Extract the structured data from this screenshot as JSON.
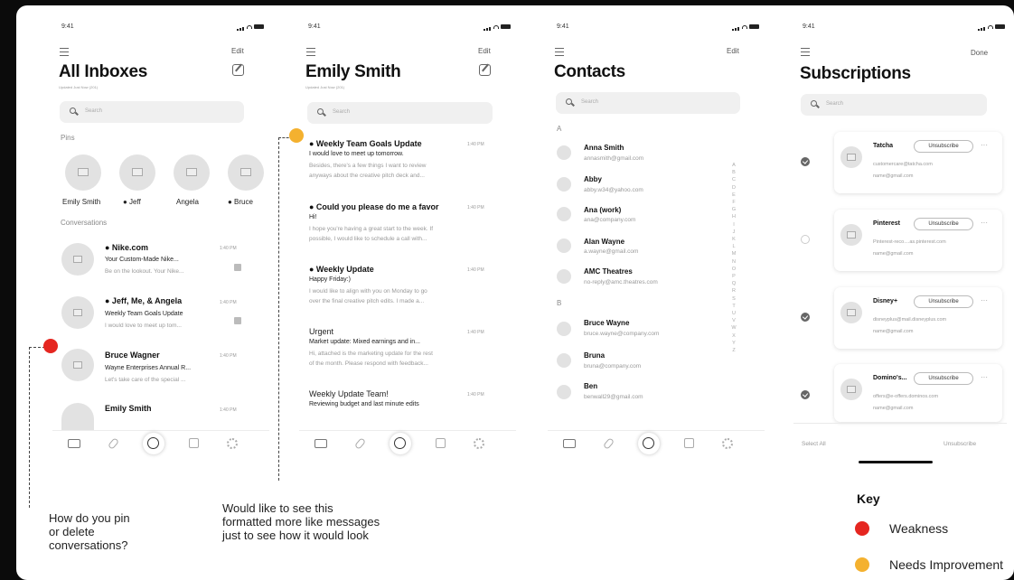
{
  "colors": {
    "weakness": "#e52620",
    "needs_improvement": "#f4b12f",
    "ink": "#111111",
    "muted": "#999999",
    "surface": "#f0f0f0"
  },
  "status_time": "9:41",
  "inboxes": {
    "title": "All Inboxes",
    "edit": "Edit",
    "updated": "Updated Just Now (201)",
    "search_placeholder": "Search",
    "pins_label": "Pins",
    "pins": [
      "Emily Smith",
      "● Jeff",
      "Angela",
      "● Bruce"
    ],
    "conversations_label": "Conversations",
    "conversations": [
      {
        "sender": "● Nike.com",
        "subject": "Your Custom-Made Nike...",
        "preview": "Be on the lookout. Your Nike...",
        "time": "1:40 PM"
      },
      {
        "sender": "● Jeff, Me, & Angela",
        "subject": "Weekly Team Goals Update",
        "preview": "I would love to meet up tom...",
        "time": "1:40 PM"
      },
      {
        "sender": "Bruce Wagner",
        "subject": "Wayne Enterprises Annual R...",
        "preview": "Let's take care of the special ...",
        "time": "1:40 PM"
      },
      {
        "sender": "Emily Smith",
        "subject": "",
        "preview": "",
        "time": "1:40 PM"
      }
    ]
  },
  "emily": {
    "title": "Emily Smith",
    "edit": "Edit",
    "updated": "Updated Just Now (201)",
    "search_placeholder": "Search",
    "messages": [
      {
        "subject": "● Weekly Team Goals Update",
        "line": "I would love to meet up tomorrow.",
        "preview1": "Besides, there's a few things I want to review",
        "preview2": "anyways about the creative pitch deck and...",
        "time": "1:40 PM"
      },
      {
        "subject": "● Could you please do me a favor",
        "line": "Hi!",
        "preview1": "I hope you're having a great start to the week. If",
        "preview2": "possible, I would like to schedule a call with...",
        "time": "1:40 PM"
      },
      {
        "subject": "● Weekly Update",
        "line": "Happy Friday:)",
        "preview1": "I would like to align with you on Monday to go",
        "preview2": "over the final creative pitch edits. I made a...",
        "time": "1:40 PM"
      },
      {
        "subject": "Urgent",
        "line": "Market update: Mixed earnings and in...",
        "preview1": "Hi, attached is the marketing update for the rest",
        "preview2": "of the month. Please respond with feedback...",
        "time": "1:40 PM"
      },
      {
        "subject": "Weekly Update Team!",
        "line": "Reviewing budget and last minute edits",
        "preview1": "",
        "preview2": "",
        "time": "1:40 PM"
      }
    ]
  },
  "contacts": {
    "title": "Contacts",
    "edit": "Edit",
    "search_placeholder": "Search",
    "section_a": "A",
    "section_b": "B",
    "list_a": [
      {
        "name": "Anna Smith",
        "email": "annasmith@gmail.com"
      },
      {
        "name": "Abby",
        "email": "abby.w34@yahoo.com"
      },
      {
        "name": "Ana (work)",
        "email": "ana@company.com"
      },
      {
        "name": "Alan Wayne",
        "email": "a.wayne@gmail.com"
      },
      {
        "name": "AMC Theatres",
        "email": "no-reply@amc.theatres.com"
      }
    ],
    "list_b": [
      {
        "name": "Bruce Wayne",
        "email": "bruce.wayne@company.com"
      },
      {
        "name": "Bruna",
        "email": "bruna@company.com"
      },
      {
        "name": "Ben",
        "email": "benwall29@gmail.com"
      }
    ],
    "alphabet": [
      "A",
      "B",
      "C",
      "D",
      "E",
      "F",
      "G",
      "H",
      "I",
      "J",
      "K",
      "L",
      "M",
      "N",
      "O",
      "P",
      "Q",
      "R",
      "S",
      "T",
      "U",
      "V",
      "W",
      "X",
      "Y",
      "Z"
    ]
  },
  "subscriptions": {
    "title": "Subscriptions",
    "done": "Done",
    "search_placeholder": "Search",
    "unsubscribe_label": "Unsubscribe",
    "items": [
      {
        "name": "Tatcha",
        "from": "customercare@tatcha.com",
        "to": "name@gmail.com",
        "selected": true
      },
      {
        "name": "Pinterest",
        "from": "Pinterest-reco....as.pinterest.com",
        "to": "name@gmail.com",
        "selected": false
      },
      {
        "name": "Disney+",
        "from": "disneyplus@mail.disneyplus.com",
        "to": "name@gmail.com",
        "selected": true
      },
      {
        "name": "Domino's...",
        "from": "offers@e-offers.dominos.com",
        "to": "name@gmail.com",
        "selected": true
      }
    ],
    "select_all": "Select All",
    "unsubscribe_footer": "Unsubscribe"
  },
  "annotations": {
    "pin_question": [
      "How do you pin",
      "or delete",
      "conversations?"
    ],
    "format_note": [
      "Would like to see this",
      "formatted more like messages",
      "just to see how it would look"
    ]
  },
  "key": {
    "title": "Key",
    "weakness": "Weakness",
    "needs_improvement": "Needs Improvement"
  }
}
